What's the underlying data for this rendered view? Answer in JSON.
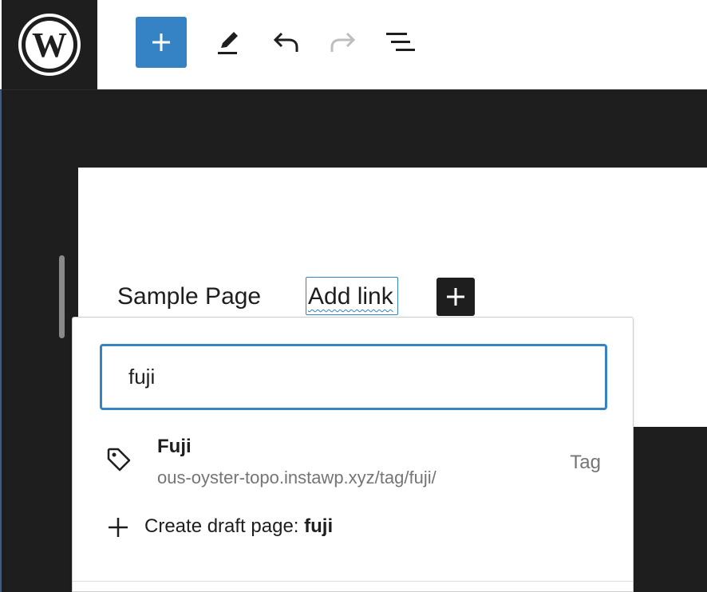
{
  "toolbar": {
    "logo_icon": "wordpress-logo-icon",
    "inserter_icon": "plus-icon",
    "tools_icon": "pencil-icon",
    "undo_icon": "undo-icon",
    "redo_icon": "redo-icon",
    "outline_icon": "list-view-icon",
    "accent_color": "#3582c4"
  },
  "navigation": {
    "items": [
      {
        "label": "Sample Page"
      },
      {
        "label": "Add link"
      }
    ],
    "appender_icon": "plus-icon"
  },
  "link_popover": {
    "search": {
      "value": "fuji"
    },
    "results": [
      {
        "icon": "tag-icon",
        "title": "Fuji",
        "url": "ous-oyster-topo.instawp.xyz/tag/fuji/",
        "type": "Tag"
      }
    ],
    "create": {
      "icon": "plus-icon",
      "label": "Create draft page: ",
      "term": "fuji"
    }
  }
}
